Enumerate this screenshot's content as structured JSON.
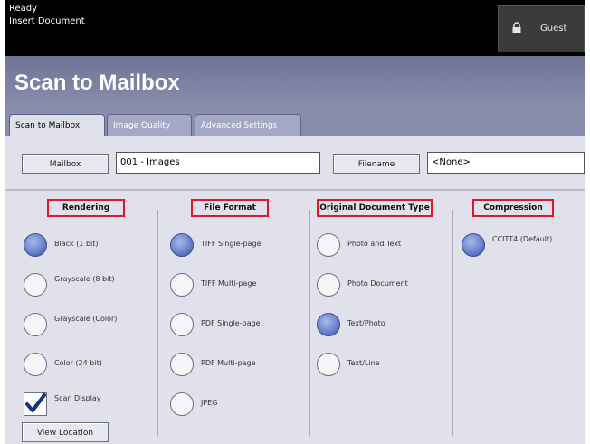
{
  "status": {
    "line1": "Ready",
    "line2": "Insert Document"
  },
  "guest_button": {
    "label": "Guest",
    "icon": "lock-icon"
  },
  "page_title": "Scan to Mailbox",
  "tabs": [
    {
      "label": "Scan to Mailbox",
      "active": true
    },
    {
      "label": "Image Quality",
      "active": false
    },
    {
      "label": "Advanced Settings",
      "active": false
    }
  ],
  "mailbox": {
    "button_label": "Mailbox",
    "value": "001 - Images"
  },
  "file_name": {
    "button_label": "Filename",
    "value": "<None>"
  },
  "columns": {
    "rendering": {
      "header": "Rendering",
      "options": [
        {
          "label": "Black (1 bit)",
          "selected": true
        },
        {
          "label": "Grayscale (8 bit)",
          "selected": false
        },
        {
          "label": "Grayscale (Color)",
          "selected": false
        },
        {
          "label": "Color (24 bit)",
          "selected": false
        }
      ],
      "checkbox": {
        "label": "Scan Display",
        "checked": true
      },
      "button": "View Location"
    },
    "file_format": {
      "header": "File Format",
      "options": [
        {
          "label": "TIFF Single-page",
          "selected": true
        },
        {
          "label": "TIFF Multi-page",
          "selected": false
        },
        {
          "label": "PDF Single-page",
          "selected": false
        },
        {
          "label": "PDF Multi-page",
          "selected": false
        },
        {
          "label": "JPEG",
          "selected": false
        }
      ]
    },
    "original_type": {
      "header": "Original Document Type",
      "options": [
        {
          "label": "Photo and Text",
          "selected": false
        },
        {
          "label": "Photo Document",
          "selected": false
        },
        {
          "label": "Text/Photo",
          "selected": true
        },
        {
          "label": "Text/Line",
          "selected": false
        }
      ]
    },
    "compression": {
      "header": "Compression",
      "options": [
        {
          "label": "CCITT4 (Default)",
          "selected": true
        }
      ]
    }
  },
  "colors": {
    "accent": "#5f79c6",
    "header_bg": "#7a7e9f",
    "highlight_border": "#e0172a"
  }
}
